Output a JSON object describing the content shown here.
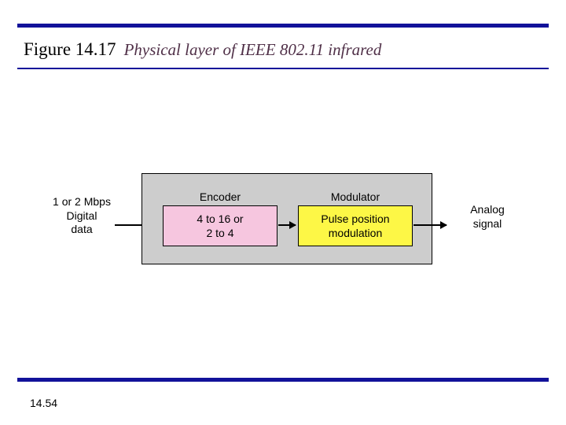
{
  "figure": {
    "number": "Figure 14.17",
    "caption": "Physical layer of IEEE 802.11 infrared"
  },
  "page_number": "14.54",
  "diagram": {
    "input": {
      "rate": "1 or 2 Mbps",
      "type_line1": "Digital",
      "type_line2": "data"
    },
    "output": {
      "type_line1": "Analog",
      "type_line2": "signal"
    },
    "encoder": {
      "header": "Encoder",
      "line1": "4 to 16 or",
      "line2": "2 to 4"
    },
    "modulator": {
      "header": "Modulator",
      "line1": "Pulse position",
      "line2": "modulation"
    }
  }
}
